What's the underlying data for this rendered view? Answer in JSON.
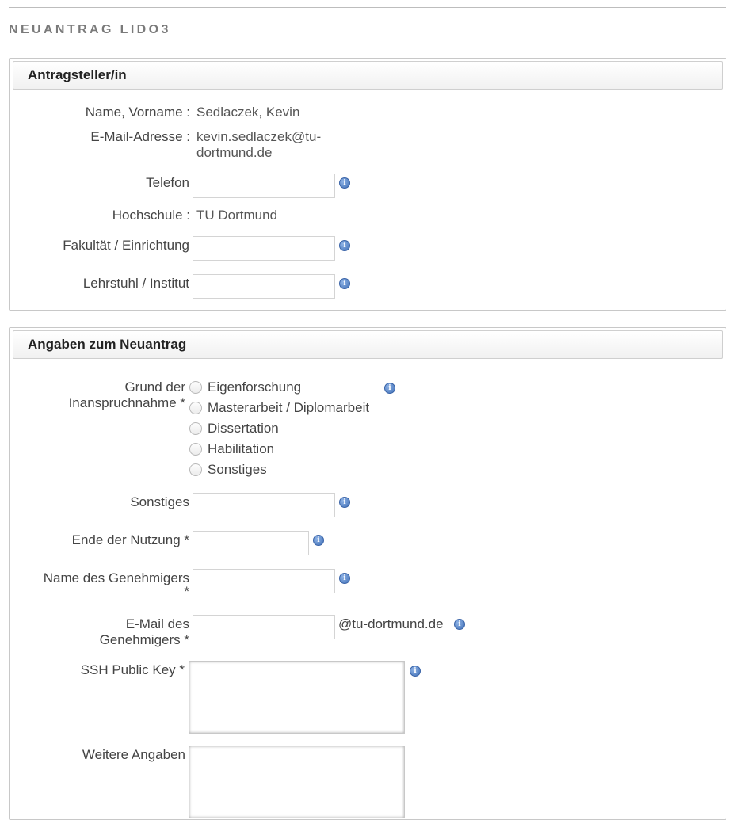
{
  "page": {
    "title": "NEUANTRAG LIDO3"
  },
  "applicant": {
    "legend": "Antragsteller/in",
    "name_label": "Name, Vorname :",
    "name_value": "Sedlaczek, Kevin",
    "email_label": "E-Mail-Adresse :",
    "email_value_line1": "kevin.sedlaczek@tu-",
    "email_value_line2": "dortmund.de",
    "phone_label": "Telefon",
    "phone_value": "",
    "university_label": "Hochschule :",
    "university_value": "TU Dortmund",
    "faculty_label": "Fakultät / Einrichtung",
    "faculty_value": "",
    "chair_label": "Lehrstuhl / Institut",
    "chair_value": ""
  },
  "request": {
    "legend": "Angaben zum Neuantrag",
    "reason_label_line1": "Grund der",
    "reason_label_line2": "Inanspruchnahme *",
    "reason_options": [
      "Eigenforschung",
      "Masterarbeit / Diplomarbeit",
      "Dissertation",
      "Habilitation",
      "Sonstiges"
    ],
    "other_label": "Sonstiges",
    "other_value": "",
    "end_label": "Ende der Nutzung *",
    "end_value": "",
    "approver_name_label_line1": "Name des Genehmigers",
    "approver_name_label_line2": "*",
    "approver_name_value": "",
    "approver_email_label_line1": "E-Mail des",
    "approver_email_label_line2": "Genehmigers *",
    "approver_email_value": "",
    "approver_email_suffix": "@tu-dortmund.de",
    "ssh_label": "SSH Public Key *",
    "ssh_value": "",
    "additional_label": "Weitere Angaben",
    "additional_value": ""
  },
  "icons": {
    "info": "info-icon",
    "info_glyph": "i"
  },
  "colors": {
    "title": "#7a7a7a",
    "info_icon": "#3f6fb6",
    "border": "#c8c8c8"
  }
}
